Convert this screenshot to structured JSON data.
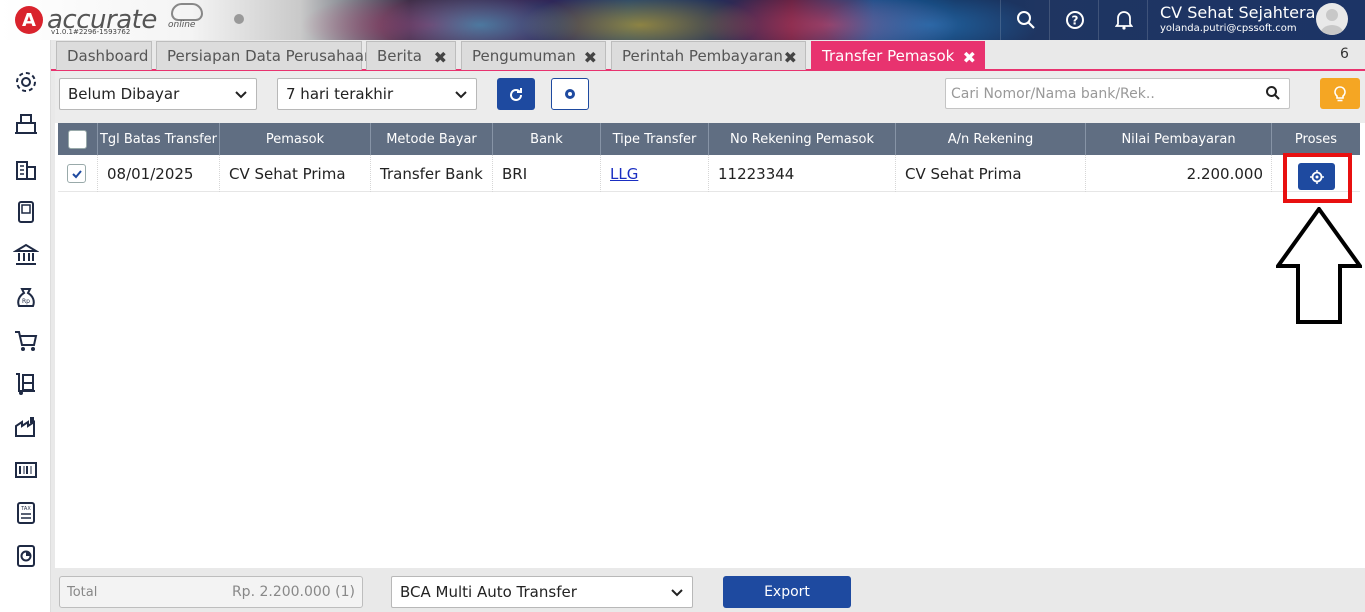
{
  "app": {
    "logo_text": "accurate",
    "logo_sub": "online",
    "version": "v1.0.1#2296-1593762",
    "company": "CV Sehat Sejahtera",
    "email": "yolanda.putri@cpssoft.com"
  },
  "tabs": [
    {
      "label": "Dashboard"
    },
    {
      "label": "Persiapan Data Perusahaan"
    },
    {
      "label": "Berita"
    },
    {
      "label": "Pengumuman"
    },
    {
      "label": "Perintah Pembayaran"
    },
    {
      "label": "Transfer Pemasok"
    }
  ],
  "tab_count": "6",
  "toolbar": {
    "status_filter": "Belum Dibayar",
    "date_filter": "7 hari terakhir",
    "search_placeholder": "Cari Nomor/Nama bank/Rek.."
  },
  "table": {
    "columns": [
      "Tgl Batas Transfer",
      "Pemasok",
      "Metode Bayar",
      "Bank",
      "Tipe Transfer",
      "No Rekening Pemasok",
      "A/n Rekening",
      "Nilai Pembayaran",
      "Proses"
    ],
    "rows": [
      {
        "tgl": "08/01/2025",
        "pemasok": "CV Sehat Prima",
        "metode": "Transfer Bank",
        "bank": "BRI",
        "tipe": "LLG",
        "no_rek": "11223344",
        "an_rek": "CV Sehat Prima",
        "nilai": "2.200.000",
        "checked": true
      }
    ]
  },
  "footer": {
    "total_label": "Total",
    "total_value": "Rp. 2.200.000 (1)",
    "bank_select": "BCA Multi Auto Transfer",
    "export_label": "Export"
  },
  "colors": {
    "accent_pink": "#e8336f",
    "primary_blue": "#1e4aa0",
    "header_gray": "#606e82",
    "highlight_red": "#e81010",
    "bulb_orange": "#f5a623"
  },
  "icons": {
    "sidebar": [
      "gear-icon",
      "cash-register-icon",
      "building-icon",
      "book-icon",
      "bank-icon",
      "money-bag-icon",
      "shopping-cart-icon",
      "inventory-cart-icon",
      "factory-icon",
      "barcode-icon",
      "tax-icon",
      "report-icon"
    ],
    "top": [
      "search-icon",
      "help-icon",
      "bell-icon",
      "avatar-icon"
    ]
  }
}
